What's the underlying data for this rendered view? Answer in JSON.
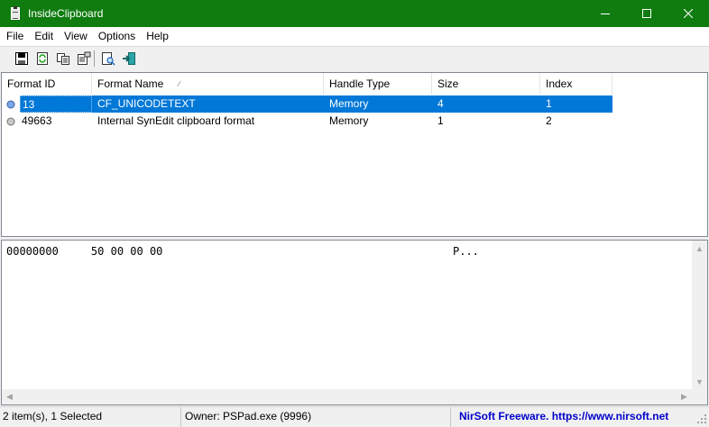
{
  "window": {
    "title": "InsideClipboard"
  },
  "menu": [
    "File",
    "Edit",
    "View",
    "Options",
    "Help"
  ],
  "toolbar": {
    "icons": [
      "save-icon",
      "refresh-icon",
      "copy-icon",
      "properties-icon",
      "find-icon",
      "exit-icon"
    ]
  },
  "table": {
    "columns": [
      "Format ID",
      "Format Name",
      "Handle Type",
      "Size",
      "Index"
    ],
    "sort_column": "Format Name",
    "rows": [
      {
        "format_id": "13",
        "format_name": "CF_UNICODETEXT",
        "handle_type": "Memory",
        "size": "4",
        "index": "1",
        "selected": true
      },
      {
        "format_id": "49663",
        "format_name": "Internal SynEdit clipboard format",
        "handle_type": "Memory",
        "size": "1",
        "index": "2",
        "selected": false
      }
    ]
  },
  "hex": {
    "offset": "00000000",
    "bytes": "50 00 00 00",
    "ascii": "P..."
  },
  "status": {
    "items": "2 item(s), 1 Selected",
    "owner": "Owner: PSPad.exe (9996)",
    "link": "NirSoft Freeware.  https://www.nirsoft.net"
  },
  "colors": {
    "titlebar": "#107c10",
    "selection": "#0078d7",
    "link": "#0000cc"
  }
}
